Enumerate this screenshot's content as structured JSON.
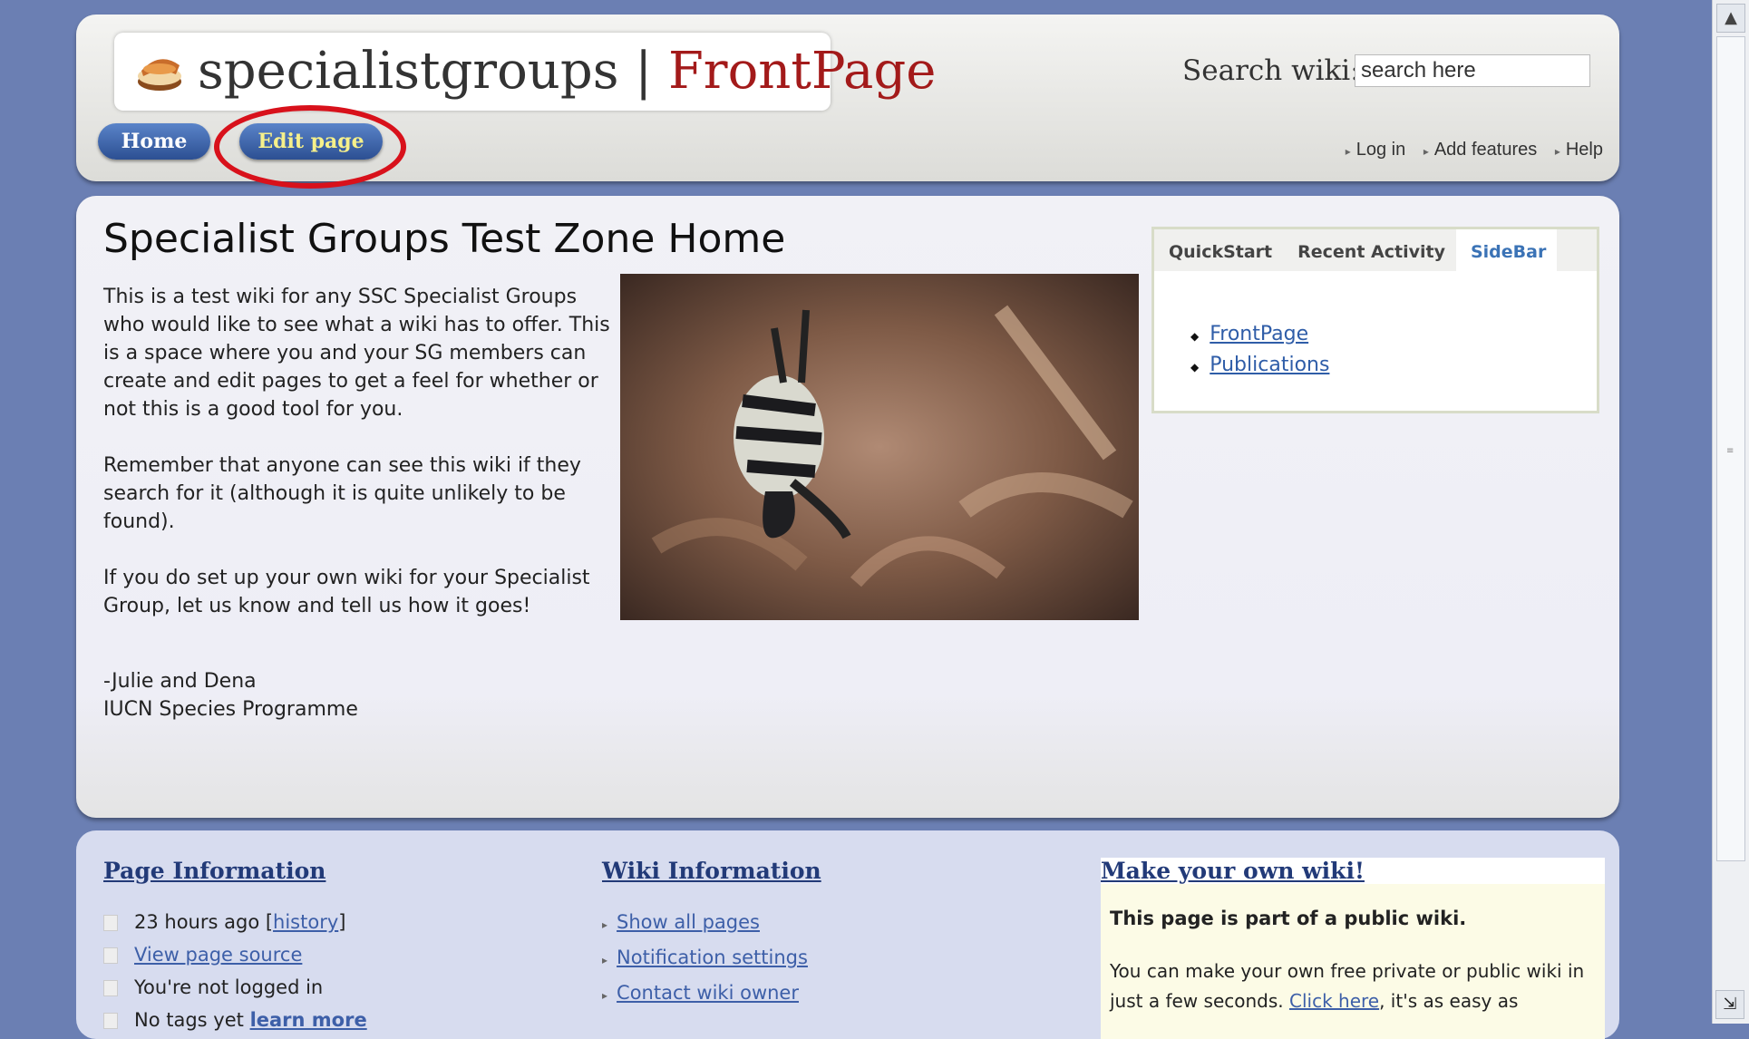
{
  "header": {
    "site_name": "specialistgroups",
    "separator": "|",
    "page_name": "FrontPage",
    "search_label": "Search wiki:",
    "search_value": "search here",
    "nav": {
      "home": "Home",
      "edit": "Edit page"
    },
    "links": {
      "login": "Log in",
      "add_features": "Add features",
      "help": "Help"
    }
  },
  "main": {
    "title": "Specialist Groups Test Zone Home",
    "paragraphs": [
      "This is a test wiki for any SSC Specialist Groups who would like to see what a wiki has to offer. This is a space where you and your SG members can create and edit pages to get a feel for whether or not this is a good tool for you.",
      "Remember that anyone can see this wiki if they search for it (although it is quite unlikely to be found).",
      "If you do set up your own wiki for your Specialist Group, let us know and tell us how it goes!"
    ],
    "signature_line1": "-Julie and Dena",
    "signature_line2": "IUCN Species Programme"
  },
  "sidebar": {
    "tabs": [
      "QuickStart",
      "Recent Activity",
      "SideBar"
    ],
    "links": [
      "FrontPage",
      "Publications"
    ]
  },
  "footer": {
    "page_info": {
      "title": "Page Information",
      "updated": "23 hours ago [",
      "history": "history",
      "updated_close": "]",
      "view_source": "View page source",
      "login_status": "You're not logged in",
      "tags": "No tags yet",
      "learn_more": "learn more"
    },
    "wiki_info": {
      "title": "Wiki Information",
      "links": [
        "Show all pages",
        "Notification settings",
        "Contact wiki owner"
      ]
    },
    "promo": {
      "title": "Make your own wiki!",
      "bold": "This page is part of a public wiki.",
      "text_start": "You can make your own free private or public wiki in just a few seconds.",
      "click_here": "Click here",
      "text_end": ", it's as easy as"
    }
  },
  "colors": {
    "background": "#6b7fb3",
    "brand_red": "#a31a1a",
    "highlight": "#d8111b",
    "link": "#2f5da8"
  }
}
